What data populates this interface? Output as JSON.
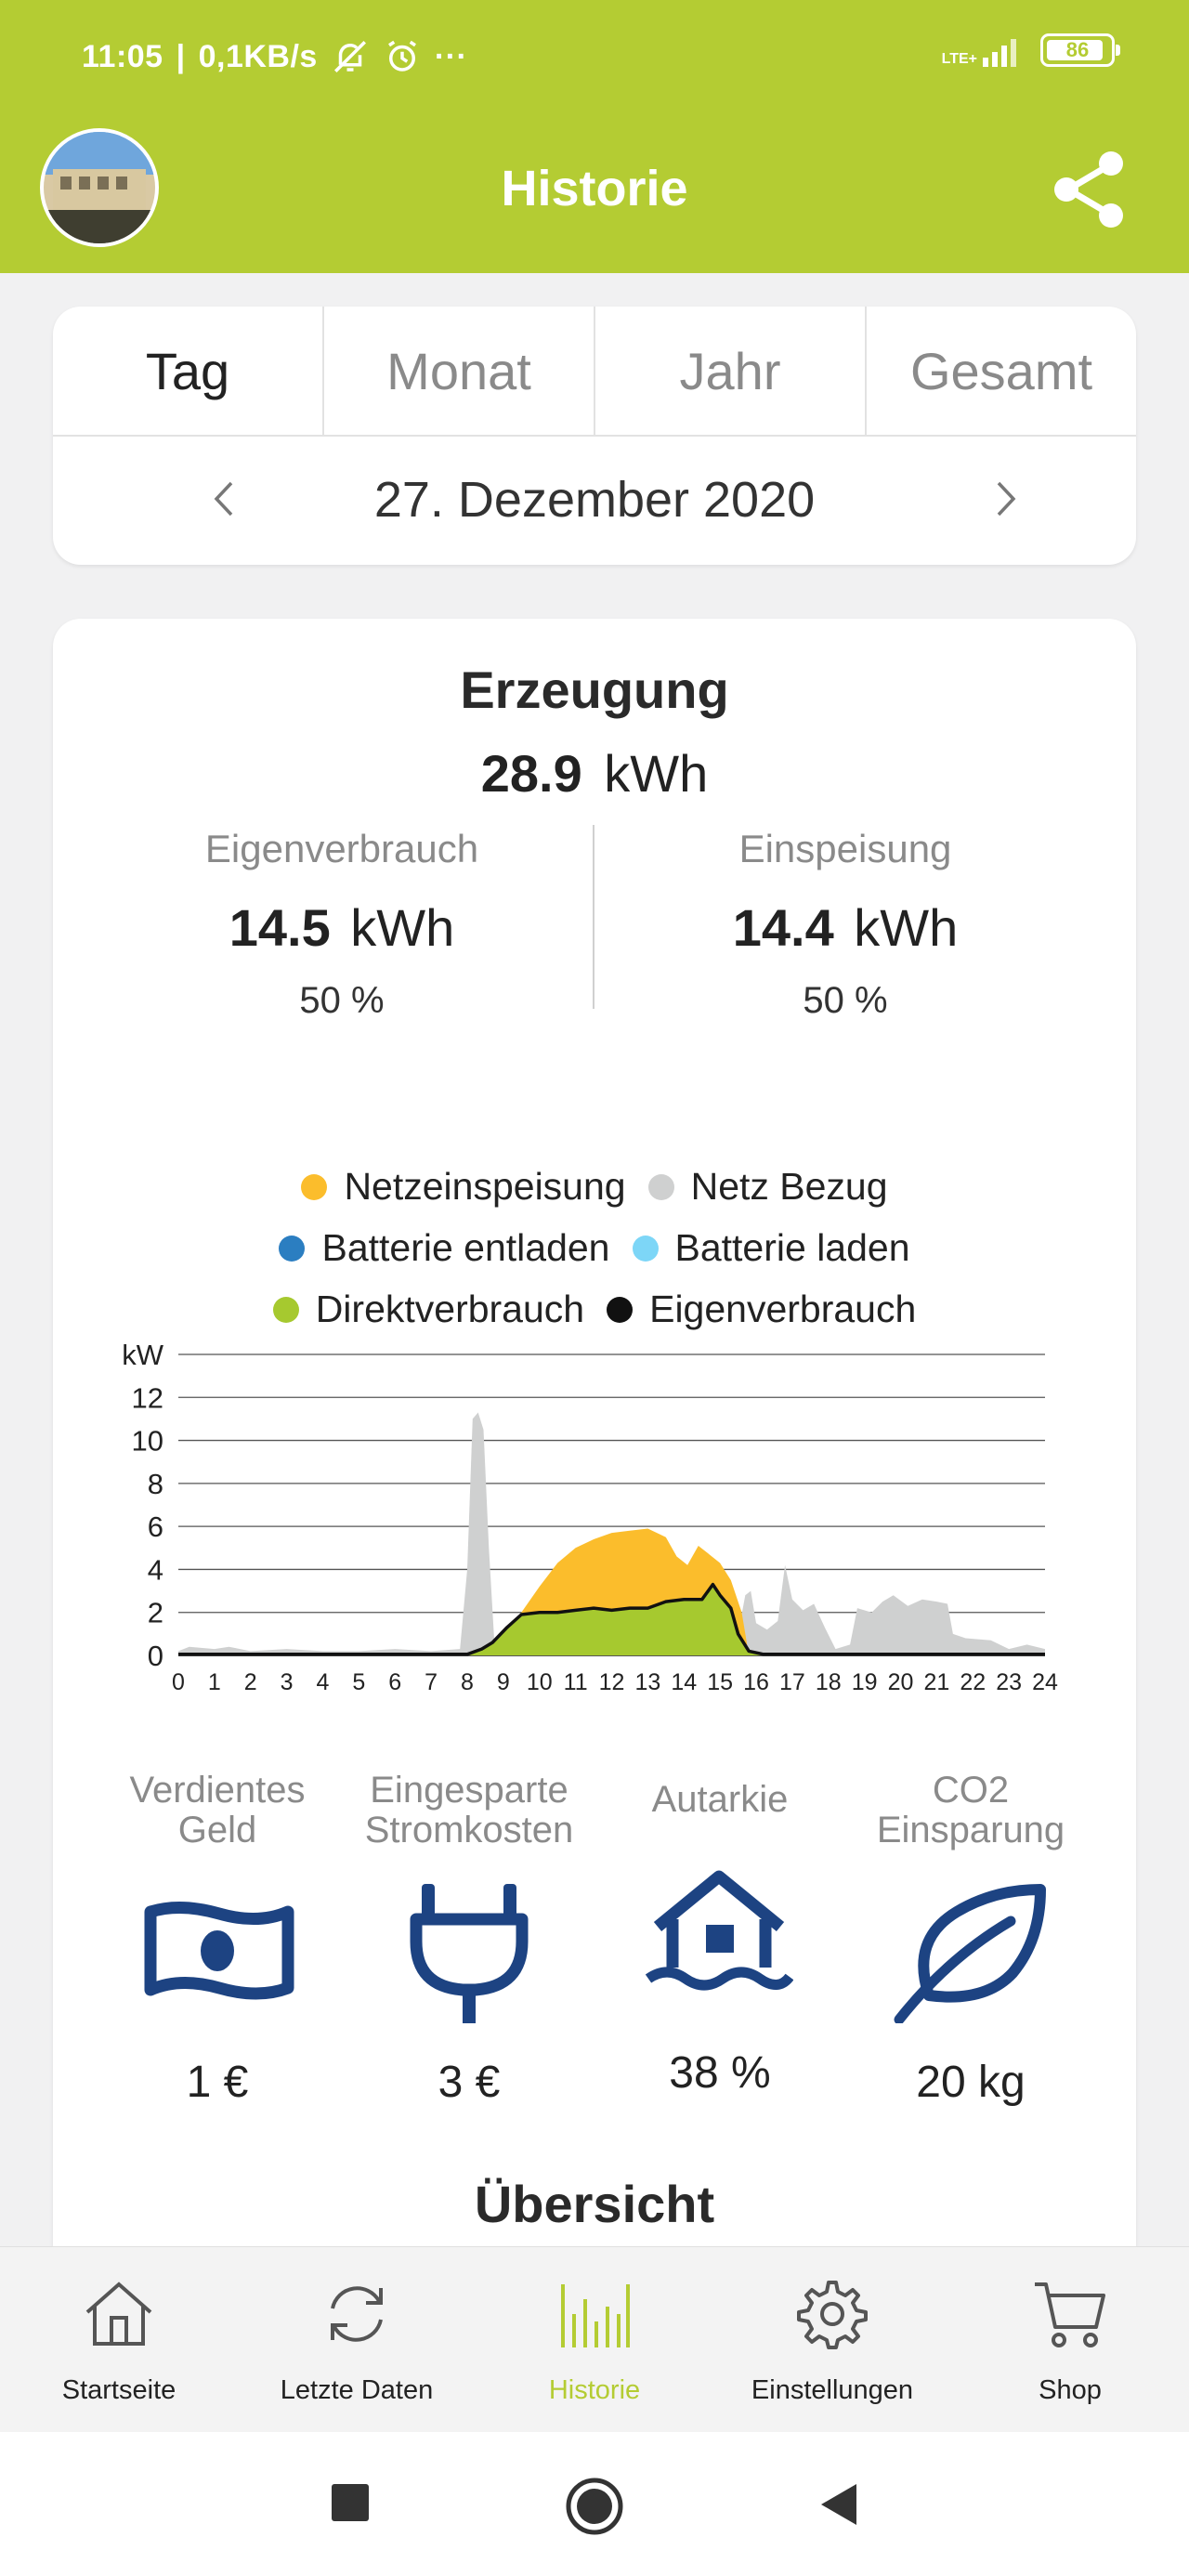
{
  "status_bar": {
    "time": "11:05",
    "speed": "0,1KB/s",
    "more": "···",
    "network": "LTE+",
    "battery": "86"
  },
  "header": {
    "title": "Historie"
  },
  "period": {
    "tabs": [
      "Tag",
      "Monat",
      "Jahr",
      "Gesamt"
    ],
    "active_tab": "Tag",
    "date": "27. Dezember 2020"
  },
  "erzeugung": {
    "title": "Erzeugung",
    "total_value": "28.9",
    "total_unit": "kWh",
    "eigenverbrauch": {
      "label": "Eigenverbrauch",
      "value": "14.5",
      "unit": "kWh",
      "percent": "50 %"
    },
    "einspeisung": {
      "label": "Einspeisung",
      "value": "14.4",
      "unit": "kWh",
      "percent": "50 %"
    }
  },
  "legend": [
    {
      "label": "Netzeinspeisung",
      "color": "#fbbd2c"
    },
    {
      "label": "Netz Bezug",
      "color": "#cfd0d0"
    },
    {
      "label": "Batterie entladen",
      "color": "#2b7ec1"
    },
    {
      "label": "Batterie laden",
      "color": "#7dd6f7"
    },
    {
      "label": "Direktverbrauch",
      "color": "#a6c92f"
    },
    {
      "label": "Eigenverbrauch",
      "color": "#111111"
    }
  ],
  "chart_data": {
    "type": "area",
    "ylabel": "kW",
    "ylim": [
      0,
      14
    ],
    "yticks": [
      0,
      2,
      4,
      6,
      8,
      10,
      12
    ],
    "xlim": [
      0,
      24
    ],
    "xticks": [
      0,
      1,
      2,
      3,
      4,
      5,
      6,
      7,
      8,
      9,
      10,
      11,
      12,
      13,
      14,
      15,
      16,
      17,
      18,
      19,
      20,
      21,
      22,
      23,
      24
    ],
    "grid": true,
    "series": [
      {
        "name": "Netz Bezug",
        "color": "#cfd0d0",
        "points": [
          [
            0,
            0.2
          ],
          [
            0.3,
            0.4
          ],
          [
            1,
            0.3
          ],
          [
            1.4,
            0.4
          ],
          [
            2,
            0.2
          ],
          [
            3,
            0.3
          ],
          [
            4,
            0.2
          ],
          [
            5,
            0.2
          ],
          [
            6,
            0.3
          ],
          [
            7,
            0.2
          ],
          [
            7.8,
            0.3
          ],
          [
            8.0,
            4
          ],
          [
            8.15,
            11.0
          ],
          [
            8.3,
            11.3
          ],
          [
            8.45,
            10.5
          ],
          [
            8.6,
            5
          ],
          [
            8.75,
            0.6
          ],
          [
            9,
            0.3
          ],
          [
            15.5,
            1.0
          ],
          [
            15.7,
            2.8
          ],
          [
            15.85,
            3.0
          ],
          [
            16.0,
            1.5
          ],
          [
            16.3,
            1.2
          ],
          [
            16.6,
            1.6
          ],
          [
            16.8,
            4.2
          ],
          [
            17.0,
            2.6
          ],
          [
            17.3,
            2.1
          ],
          [
            17.6,
            2.4
          ],
          [
            17.9,
            1.3
          ],
          [
            18.2,
            0.3
          ],
          [
            18.6,
            0.5
          ],
          [
            18.8,
            2.2
          ],
          [
            19.2,
            2.0
          ],
          [
            19.5,
            2.5
          ],
          [
            19.8,
            2.8
          ],
          [
            20.2,
            2.3
          ],
          [
            20.6,
            2.6
          ],
          [
            21.0,
            2.5
          ],
          [
            21.3,
            2.4
          ],
          [
            21.45,
            1.0
          ],
          [
            21.8,
            0.8
          ],
          [
            22.5,
            0.7
          ],
          [
            23,
            0.3
          ],
          [
            23.5,
            0.5
          ],
          [
            24,
            0.3
          ]
        ]
      },
      {
        "name": "Netzeinspeisung",
        "color": "#fbbd2c",
        "points": [
          [
            8.8,
            0
          ],
          [
            9.5,
            2.0
          ],
          [
            10,
            3.2
          ],
          [
            10.5,
            4.3
          ],
          [
            11,
            5.0
          ],
          [
            11.5,
            5.4
          ],
          [
            12,
            5.7
          ],
          [
            12.5,
            5.8
          ],
          [
            13,
            5.9
          ],
          [
            13.5,
            5.5
          ],
          [
            13.8,
            4.6
          ],
          [
            14.1,
            4.2
          ],
          [
            14.4,
            5.1
          ],
          [
            14.7,
            4.7
          ],
          [
            15.0,
            4.3
          ],
          [
            15.3,
            3.5
          ],
          [
            15.6,
            2.0
          ],
          [
            15.8,
            0
          ]
        ]
      },
      {
        "name": "Direktverbrauch",
        "color": "#a6c92f",
        "points": [
          [
            8.0,
            0
          ],
          [
            8.4,
            0.3
          ],
          [
            8.7,
            0.6
          ],
          [
            9.1,
            1.3
          ],
          [
            9.5,
            1.9
          ],
          [
            10,
            2.0
          ],
          [
            10.5,
            2.0
          ],
          [
            11,
            2.1
          ],
          [
            11.5,
            2.2
          ],
          [
            12,
            2.1
          ],
          [
            12.5,
            2.2
          ],
          [
            13,
            2.2
          ],
          [
            13.5,
            2.5
          ],
          [
            14,
            2.6
          ],
          [
            14.5,
            2.6
          ],
          [
            14.8,
            3.3
          ],
          [
            15.0,
            2.8
          ],
          [
            15.3,
            2.2
          ],
          [
            15.5,
            1.0
          ],
          [
            15.8,
            0.2
          ],
          [
            16.2,
            0
          ]
        ]
      },
      {
        "name": "Eigenverbrauch",
        "color": "#111111",
        "points": [
          [
            0,
            0.05
          ],
          [
            8.0,
            0.05
          ],
          [
            8.4,
            0.3
          ],
          [
            8.7,
            0.6
          ],
          [
            9.1,
            1.3
          ],
          [
            9.5,
            1.9
          ],
          [
            10,
            2.0
          ],
          [
            10.5,
            2.0
          ],
          [
            11,
            2.1
          ],
          [
            11.5,
            2.2
          ],
          [
            12,
            2.1
          ],
          [
            12.5,
            2.2
          ],
          [
            13,
            2.2
          ],
          [
            13.5,
            2.5
          ],
          [
            14,
            2.6
          ],
          [
            14.5,
            2.6
          ],
          [
            14.8,
            3.3
          ],
          [
            15.0,
            2.8
          ],
          [
            15.3,
            2.2
          ],
          [
            15.5,
            1.0
          ],
          [
            15.8,
            0.2
          ],
          [
            16.2,
            0.05
          ],
          [
            24,
            0.05
          ]
        ]
      }
    ]
  },
  "stats": [
    {
      "label_line1": "Verdientes",
      "label_line2": "Geld",
      "value": "1 €",
      "icon": "money-icon"
    },
    {
      "label_line1": "Eingesparte",
      "label_line2": "Stromkosten",
      "value": "3 €",
      "icon": "plug-icon"
    },
    {
      "label_line1": "Autarkie",
      "label_line2": "",
      "value": "38 %",
      "icon": "house-icon"
    },
    {
      "label_line1": "CO2",
      "label_line2": "Einsparung",
      "value": "20 kg",
      "icon": "leaf-icon"
    }
  ],
  "overview_title": "Übersicht",
  "bottom_nav": [
    {
      "label": "Startseite",
      "icon": "home-icon"
    },
    {
      "label": "Letzte Daten",
      "icon": "refresh-icon"
    },
    {
      "label": "Historie",
      "icon": "history-icon"
    },
    {
      "label": "Einstellungen",
      "icon": "gear-icon"
    },
    {
      "label": "Shop",
      "icon": "cart-icon"
    }
  ],
  "colors": {
    "brand": "#b4cc33",
    "icon_blue": "#1d4382"
  }
}
